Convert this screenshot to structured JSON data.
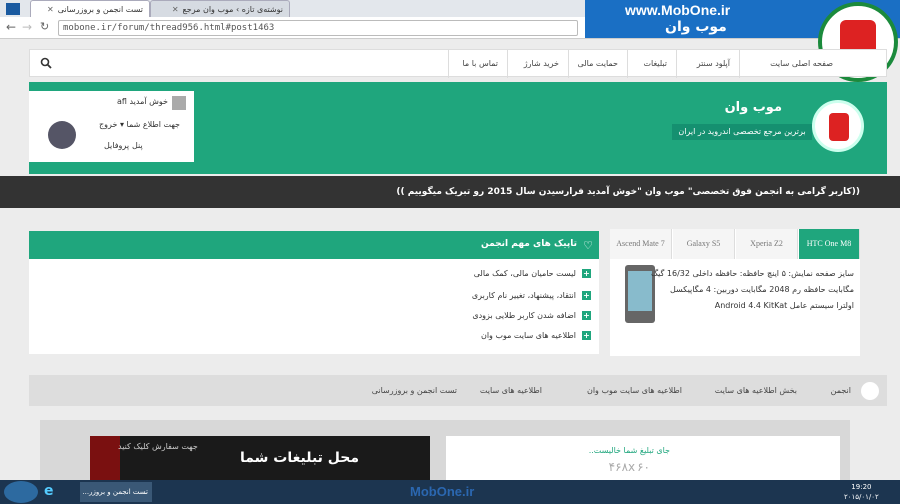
{
  "browser": {
    "tabs": [
      {
        "label": "تست انجمن و بروزرسانی"
      },
      {
        "label": "نوشته‌ی تازه › موب وان مرجع"
      }
    ],
    "address": "mobone.ir/forum/thread956.html#post1463"
  },
  "brand_corner": {
    "url_text": "www.MobOne.ir",
    "name": "موب وان"
  },
  "nav": {
    "items": [
      "صفحه اصلی سایت",
      "آپلود سنتر",
      "تبلیغات",
      "حمایت مالی",
      "خرید شارژ",
      "تماس با ما"
    ]
  },
  "welcome": {
    "greeting": "خوش آمدید afl",
    "notifications": "جهت اطلاع شما",
    "logout": "خروج",
    "profile": "پروفایل",
    "panel": "پنل"
  },
  "site": {
    "title": "موب وان",
    "subtitle": "برترین مرجع تخصصی اندروید در ایران"
  },
  "announcement": "((کاربر گرامی به انجمن فوق تخصصی\" موب وان \"خوش آمدید فرارسیدن سال 2015 رو تبریک میگوییم ))",
  "topics": {
    "header": "تاپیک های مهم انجمن",
    "items": [
      "لیست حامیان مالی، کمک مالی",
      "انتقاد، پیشنهاد، تغییر نام کاربری",
      "اضافه شدن کاربر طلایی بزودی",
      "اطلاعیه های سایت موب وان"
    ]
  },
  "phones": {
    "tabs": [
      "HTC One M8",
      "Xperia Z2",
      "Galaxy S5",
      "Ascend Mate 7"
    ],
    "spec_lines": [
      "سایز صفحه نمایش: ۵ اینچ حافظه: حافظه داخلی 16/32 گیگ",
      "مگابایت حافظه رم 2048 مگابایت دوربین: 4 مگاپیکسل",
      "اولترا سیستم عامل Android 4.4 KitKat"
    ]
  },
  "breadcrumbs": [
    "انجمن",
    "بخش اطلاعیه های سایت",
    "اطلاعیه های سایت موب وان",
    "اطلاعیه های سایت",
    "تست انجمن و بروزرسانی"
  ],
  "ads": {
    "banner_title": "محل تبلیغات شما",
    "banner_sub": "جهت سفارش کلیک کنید",
    "slot_text": "جای تبلیغ شما خالیست..",
    "slot_size": "۴۶۸x۶۰"
  },
  "taskbar": {
    "chrome_label": "تست انجمن و بروزر...",
    "watermark": "MobOne.ir",
    "time": "19:20",
    "date": "۲۰۱۵/۰۱/۰۲"
  }
}
